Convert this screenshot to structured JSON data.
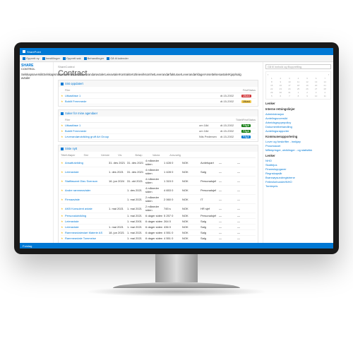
{
  "topbar": {
    "product": "SharePoint"
  },
  "ribbon": {
    "items": [
      "Opprett ny",
      "Innstillinger",
      "Opprett sak",
      "Behandlinger",
      "Gå til kalender"
    ]
  },
  "search": {
    "placeholder": "Gå til innhold og filoppretting"
  },
  "logo": {
    "line1": "SHARE",
    "line2": "CONTROL"
  },
  "nav": {
    "items": [
      "Selskapsoversikt",
      "Selskapsmøter",
      "Leverandører",
      "Leverandøravtaler",
      "Leieavtaler",
      "Kontrakter",
      "Utleievirksomhet",
      "Leverandørfakturaer",
      "Leverandørklager",
      "Ansettelsesavtaler",
      "Kjøp/salg avtaler"
    ]
  },
  "crumb": "ShareControl",
  "title": "Contract",
  "panel1": {
    "header": "Sist oppdatert",
    "colFiler": "Filer",
    "colFrist": "Frist",
    "colStatus": "Status",
    "rows": [
      {
        "name": "Utkastfase 1",
        "frist": "dt.15-2002",
        "badge": "Utkast",
        "bcl": "bg-red"
      },
      {
        "name": "Bobilt Fremmede",
        "frist": "dt.15-2002",
        "badge": "Utkast",
        "bcl": "bg-yel"
      }
    ]
  },
  "panel2": {
    "header": "Saker for mine agendaer",
    "colFiler": "Filer",
    "colTid": "Tildelt",
    "colFrist": "Frist",
    "colStatus": "Status",
    "rows": [
      {
        "name": "Utkastfase 1",
        "tid": "om 18d",
        "frist": "dt.15-2002",
        "badge": "Pågår",
        "bcl": "bg-grn"
      },
      {
        "name": "Bobilt Fremmede",
        "tid": "om 18d",
        "frist": "dt.15-2002",
        "badge": "Pågår",
        "bcl": "bg-grn"
      },
      {
        "name": "Leverandørutvikling gruff Art Group",
        "tid": "Nils Pedersen",
        "frist": "dt.15-2002",
        "badge": "Pågår",
        "bcl": "bg-blu"
      }
    ]
  },
  "panel3": {
    "header": "Siste nytt",
    "cols": [
      "Tittel",
      "Utløper",
      "Sist",
      "Værste",
      "Vis",
      "Beløp",
      "Valuta",
      "Ansvarlig",
      "",
      "",
      "",
      ""
    ],
    "rows": [
      {
        "t": "Ansattutvikling",
        "d1": "31. des 2021",
        "d2": "31. des 2021",
        "d3": "4 måneder siden",
        "v": "1 428 0",
        "cur": "NOK",
        "a": "Avdelspart"
      },
      {
        "t": "Leieravtale",
        "d1": "1. des 2021",
        "d2": "31. des 2021",
        "d3": "4 måneder siden",
        "v": "1 428 0",
        "cur": "NOK",
        "a": "Salg"
      },
      {
        "t": "Statlfasamt Olav Svenson",
        "d1": "16. jun 2024",
        "d2": "31. okt 2021",
        "d3": "4 måneder siden",
        "v": "1 315 0",
        "cur": "NOK",
        "a": "Personalsjef"
      },
      {
        "t": "Andre rammeavtaler",
        "d1": "",
        "d2": "1. des 2021",
        "d3": "4 måneder siden",
        "v": "4 653 0",
        "cur": "NOK",
        "a": "Personalsjef"
      },
      {
        "t": "Firmaavtale",
        "d1": "",
        "d2": "1. mai 2021",
        "d3": "2 måneder siden",
        "v": "2 060 0",
        "cur": "NOK",
        "a": "IT"
      },
      {
        "t": "AKB Konsulent avtale",
        "d1": "1. mai 2021",
        "d2": "1. mai 2021",
        "d3": "2 måneder siden",
        "v": "745 s",
        "cur": "NOK",
        "a": "HR sjef"
      },
      {
        "t": "Personalutvikling",
        "d1": "",
        "d2": "1. mai 2021",
        "d3": "6 dager siden",
        "v": "5 257 0",
        "cur": "NOK",
        "a": "Personalsjef"
      },
      {
        "t": "Leieravtale",
        "d1": "",
        "d2": "1. mai 2001",
        "d3": "6 dager siden",
        "v": "264 0",
        "cur": "NOK",
        "a": "Salg"
      },
      {
        "t": "Leieravtale",
        "d1": "1. mai 2021",
        "d2": "1. mai 2021",
        "d3": "6 dager siden",
        "v": "436 0",
        "cur": "NOK",
        "a": "Salg"
      },
      {
        "t": "Rammeavtalestart Materie AS",
        "d1": "18. jun 2021",
        "d2": "1. mai 2021",
        "d3": "6 dager siden",
        "v": "4 551 0",
        "cur": "NOK",
        "a": "Salg"
      },
      {
        "t": "Rammeavtale Tommeise",
        "d1": "",
        "d2": "1. mai 2021",
        "d3": "6 dager siden",
        "v": "4 551 0",
        "cur": "NOK",
        "a": "Salg"
      }
    ]
  },
  "right": {
    "linksH": "Lenker",
    "group1": {
      "h": "Interne retningslinjer",
      "items": [
        "Administrasjon",
        "Avdelingsoversikt",
        "Arbeidsgruppepolicy",
        "Dokumentbehandling",
        "Avdelingsrapporter"
      ]
    },
    "group2": {
      "h": "Kommunerapportering",
      "items": [
        "Lover og forskrifter - innkjøp",
        "Prosesskart",
        "Målstyringer, utviklinger - og statisitkk"
      ]
    },
    "group3": {
      "h": "Lenker",
      "items": [
        "NHO",
        "Skattejus",
        "Finansloppgaver",
        "Regnskapsår",
        "Brønnøysundregistrene",
        "Fellesforbundet/NHO",
        "Tomtepris"
      ]
    }
  },
  "footer": "Forslag"
}
